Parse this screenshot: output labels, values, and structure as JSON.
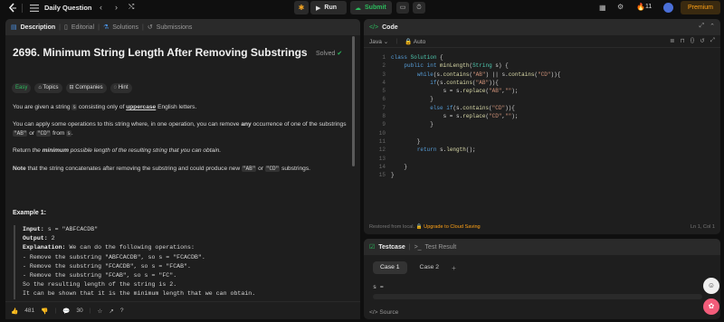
{
  "topbar": {
    "title": "Daily Question",
    "run_label": "Run",
    "submit_label": "Submit",
    "streak": "11",
    "premium_label": "Premium"
  },
  "left": {
    "tabs": [
      "Description",
      "Editorial",
      "Solutions",
      "Submissions"
    ],
    "title": "2696. Minimum String Length After Removing Substrings",
    "solved_label": "Solved",
    "tags": [
      "Easy",
      "Topics",
      "Companies",
      "Hint"
    ],
    "p1_a": "You are given a string ",
    "p1_code": "s",
    "p1_b": " consisting only of ",
    "p1_bold": "uppercase",
    "p1_c": " English letters.",
    "p2_a": "You can apply some operations to this string where, in one operation, you can remove ",
    "p2_bold": "any",
    "p2_b": " occurrence of one of the substrings ",
    "p2_code1": "\"AB\"",
    "p2_or": " or ",
    "p2_code2": "\"CD\"",
    "p2_c": " from ",
    "p2_code3": "s",
    "p2_d": ".",
    "p3_a": "Return ",
    "p3_em": "the ",
    "p3_bold": "minimum",
    "p3_b": " possible length of the resulting string that you can obtain.",
    "p4_bold": "Note",
    "p4_a": " that the string concatenates after removing the substring and could produce new ",
    "p4_code1": "\"AB\"",
    "p4_or": " or ",
    "p4_code2": "\"CD\"",
    "p4_b": " substrings.",
    "example_title": "Example 1:",
    "example": {
      "input_label": "Input:",
      "input": " s = \"ABFCACDB\"",
      "output_label": "Output:",
      "output": " 2",
      "explanation_label": "Explanation:",
      "explanation": " We can do the following operations:",
      "lines": [
        "- Remove the substring \"ABFCACDB\", so s = \"FCACDB\".",
        "- Remove the substring \"FCACDB\", so s = \"FCAB\".",
        "- Remove the substring \"FCAB\", so s = \"FC\".",
        "So the resulting length of the string is 2.",
        "It can be shown that it is the minimum length that we can obtain."
      ]
    },
    "likes": "481",
    "comments": "30"
  },
  "code": {
    "tab_label": "Code",
    "language": "Java",
    "auto_label": "Auto",
    "line_numbers": [
      "1",
      "2",
      "3",
      "4",
      "5",
      "6",
      "7",
      "8",
      "9",
      "10",
      "11",
      "12",
      "13",
      "14",
      "15"
    ],
    "footer_left": "Restored from local.",
    "footer_upgrade": "Upgrade to Cloud Saving",
    "footer_right": "Ln 1, Col 1"
  },
  "testcase": {
    "tab_label": "Testcase",
    "result_label": "Test Result",
    "cases": [
      "Case 1",
      "Case 2"
    ],
    "var_label": "s =",
    "footer": "Source"
  },
  "colors": {
    "accent_green": "#2cbb5d",
    "brand_orange": "#ffa116",
    "panel_bg": "#1e1e1e"
  }
}
